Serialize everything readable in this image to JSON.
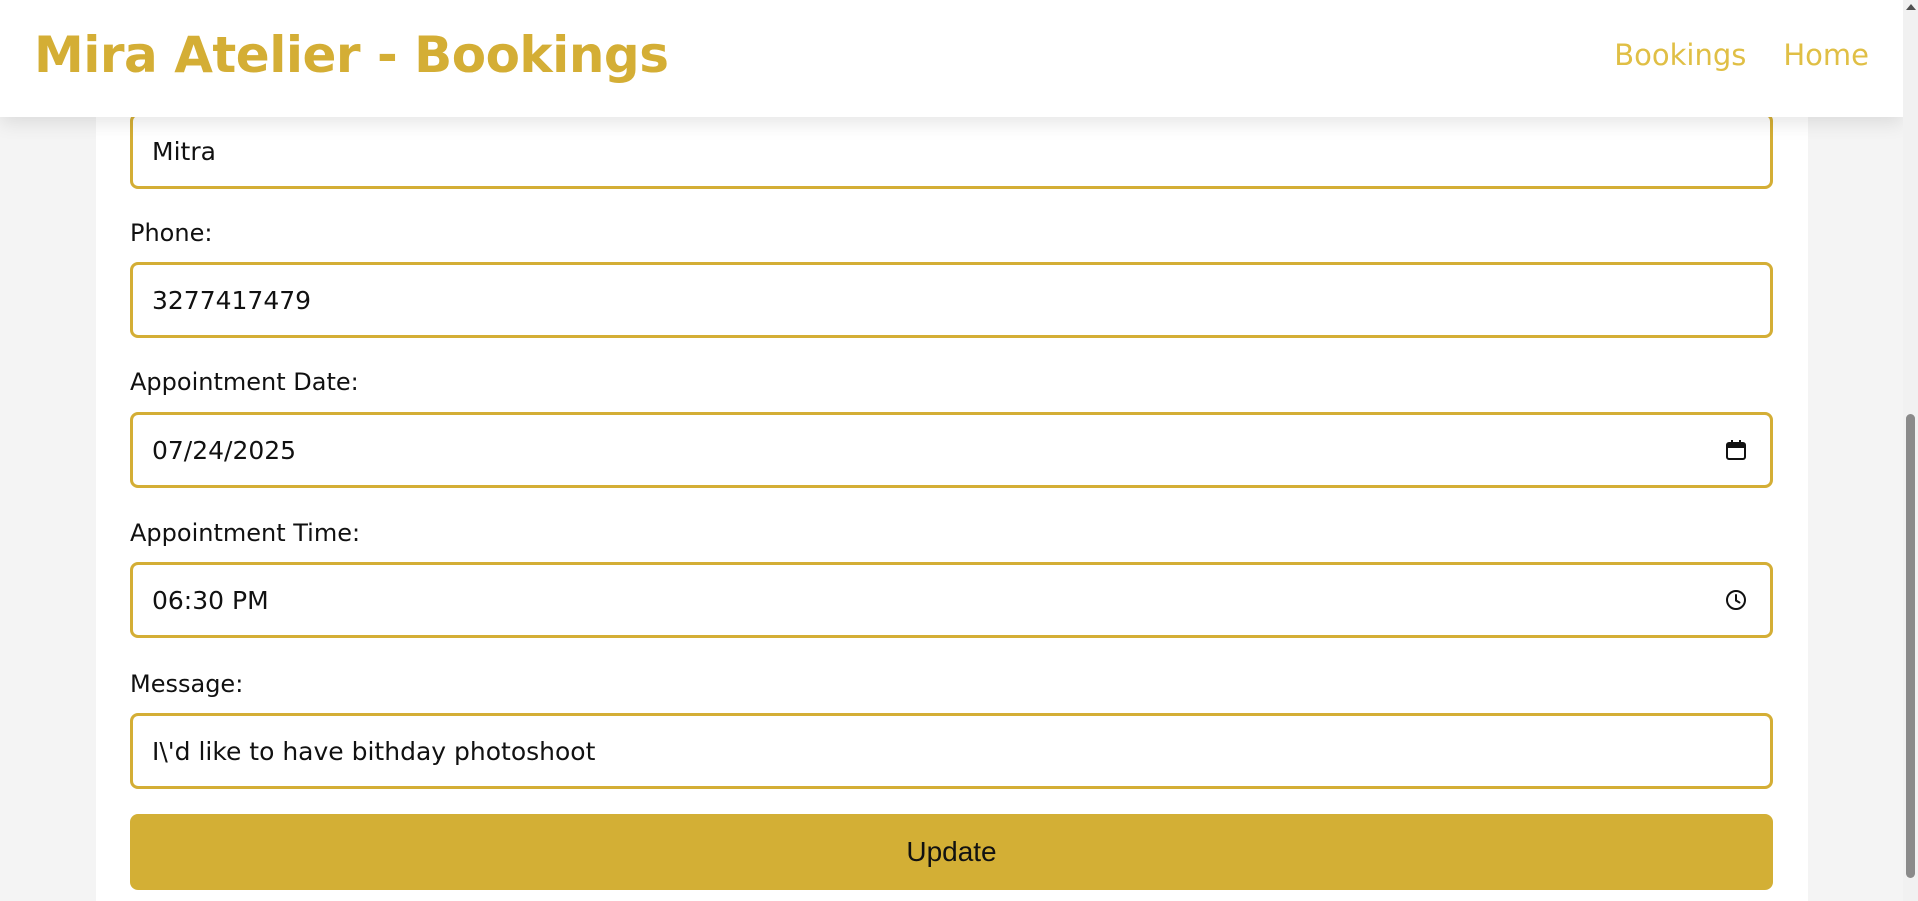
{
  "header": {
    "brand": "Mira Atelier - Bookings",
    "nav": {
      "bookings": "Bookings",
      "home": "Home"
    }
  },
  "form": {
    "name_value": "Mitra",
    "phone_label": "Phone:",
    "phone_value": "3277417479",
    "date_label": "Appointment Date:",
    "date_value": "07/24/2025",
    "time_label": "Appointment Time:",
    "time_value": "06:30 PM",
    "message_label": "Message:",
    "message_value": "I\\'d like to have bithday photoshoot",
    "submit_label": "Update"
  },
  "icons": {
    "date": "calendar-icon",
    "time": "clock-icon"
  },
  "colors": {
    "accent": "#d4ae35",
    "nav": "#e0bf45",
    "button": "#d3af35"
  }
}
